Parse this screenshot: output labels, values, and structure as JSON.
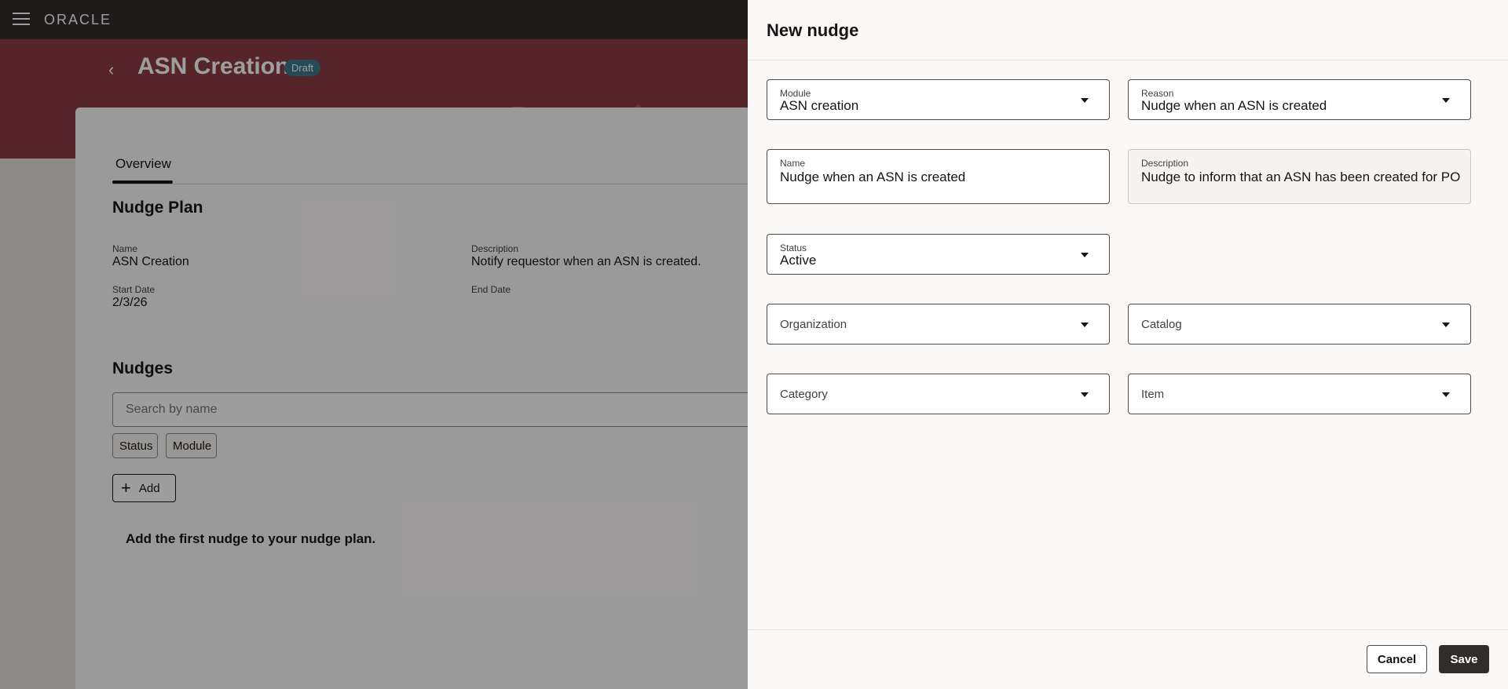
{
  "app": {
    "logo": "ORACLE",
    "page_title": "ASN Creation",
    "status_badge": "Draft",
    "tab_overview": "Overview"
  },
  "plan": {
    "section_title": "Nudge Plan",
    "name_label": "Name",
    "name_value": "ASN Creation",
    "description_label": "Description",
    "description_value": "Notify requestor when an ASN is created.",
    "start_label": "Start Date",
    "start_value": "2/3/26",
    "end_label": "End Date"
  },
  "nudges": {
    "section_title": "Nudges",
    "search_placeholder": "Search by name",
    "filter_status": "Status",
    "filter_module": "Module",
    "add_label": "Add",
    "empty_message": "Add the first nudge to your nudge plan."
  },
  "drawer": {
    "title": "New nudge",
    "module": {
      "label": "Module",
      "value": "ASN creation"
    },
    "reason": {
      "label": "Reason",
      "value": "Nudge when an ASN is created"
    },
    "name": {
      "label": "Name",
      "value": "Nudge when an ASN is created"
    },
    "description": {
      "label": "Description",
      "value": "Nudge to inform that an ASN has been created for PO"
    },
    "status": {
      "label": "Status",
      "value": "Active"
    },
    "organization": {
      "placeholder": "Organization"
    },
    "catalog": {
      "placeholder": "Catalog"
    },
    "category": {
      "placeholder": "Category"
    },
    "item": {
      "placeholder": "Item"
    },
    "cancel_label": "Cancel",
    "save_label": "Save"
  }
}
